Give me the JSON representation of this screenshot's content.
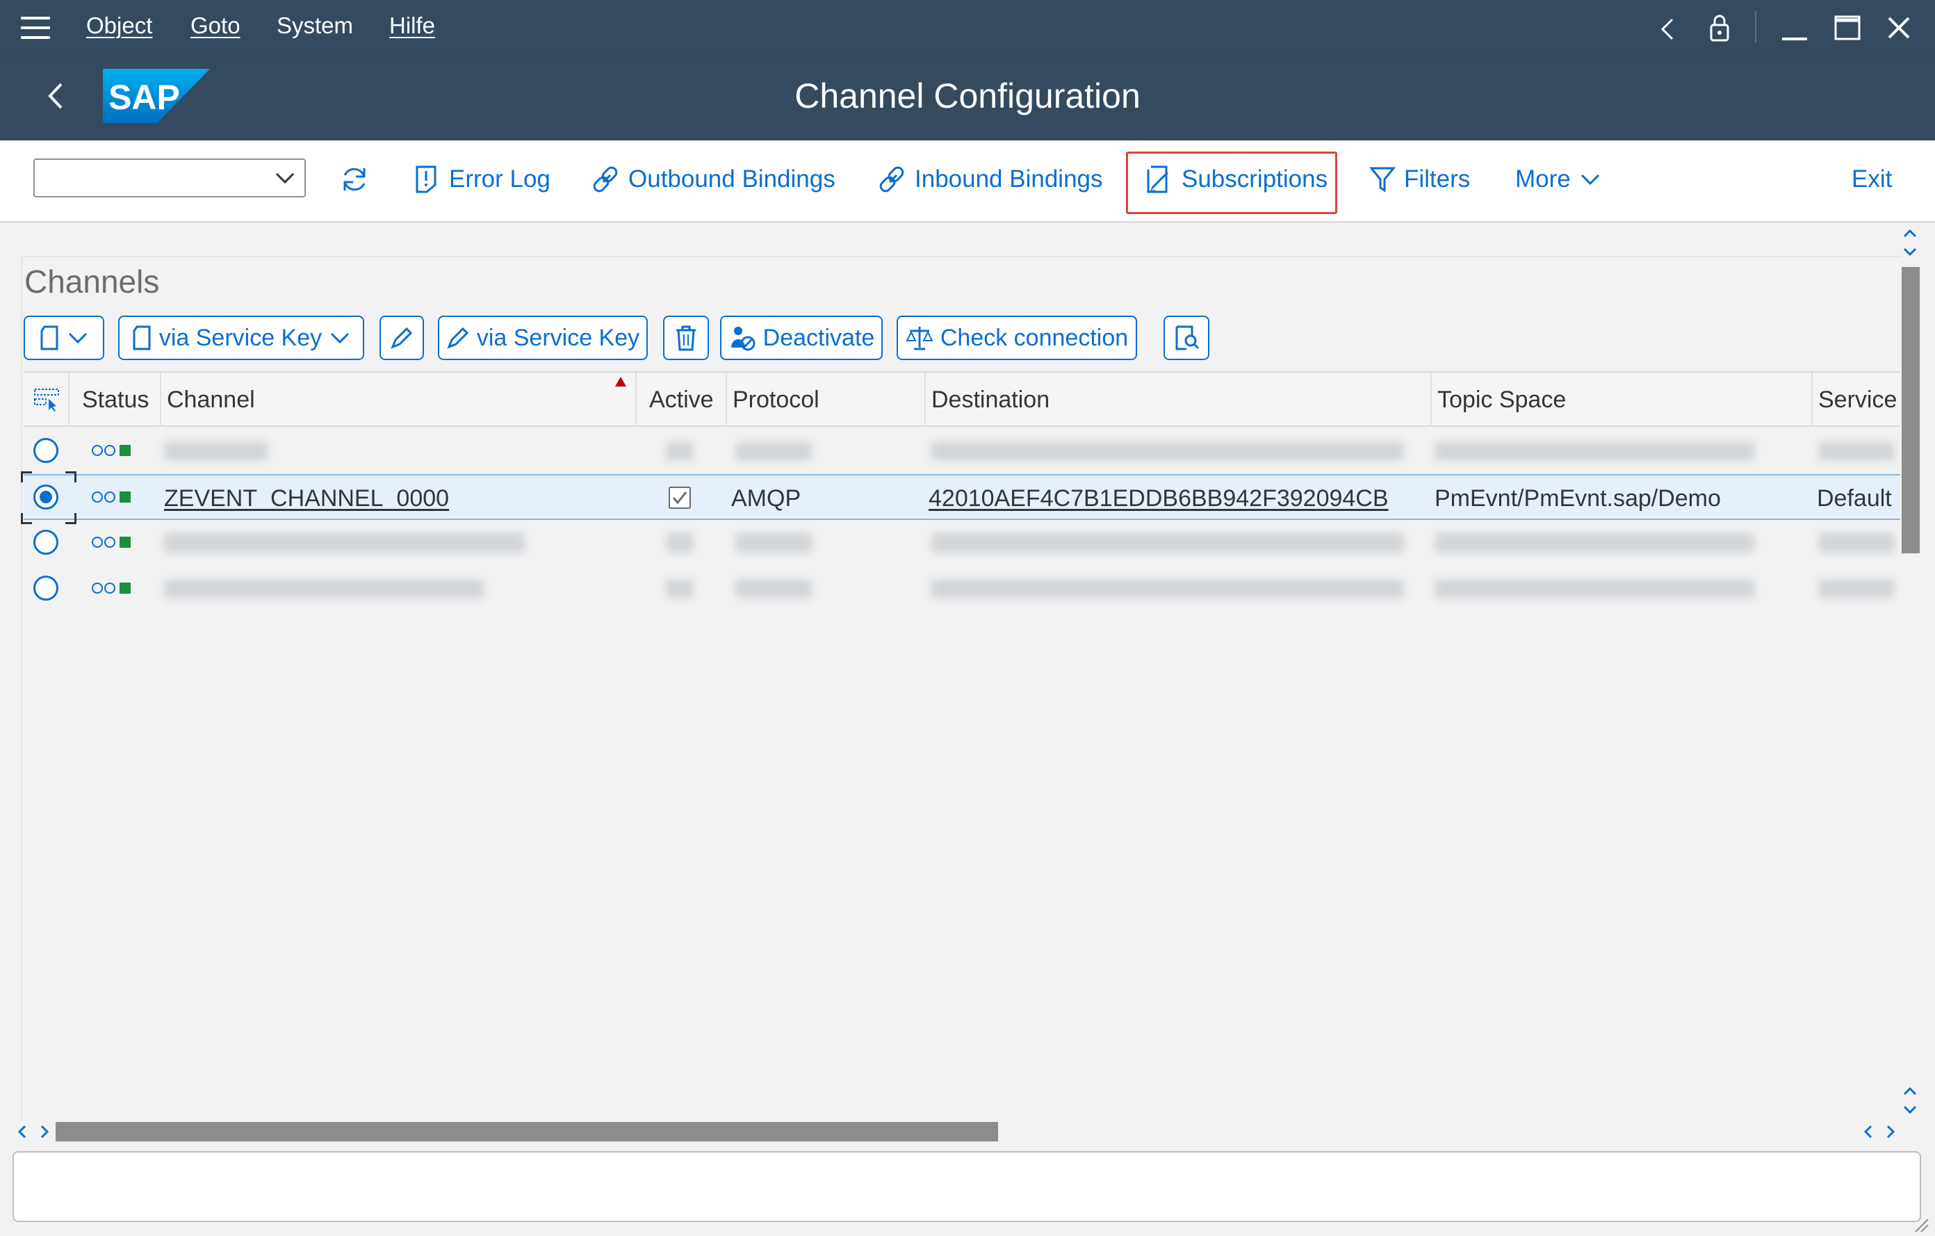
{
  "menubar": {
    "items": [
      "Object",
      "Goto",
      "System",
      "Hilfe"
    ]
  },
  "header": {
    "title": "Channel Configuration"
  },
  "toolbar": {
    "combo_value": "",
    "error_log": "Error Log",
    "outbound_bindings": "Outbound Bindings",
    "inbound_bindings": "Inbound Bindings",
    "subscriptions": "Subscriptions",
    "filters": "Filters",
    "more": "More",
    "exit": "Exit"
  },
  "panel": {
    "title": "Channels",
    "buttons": {
      "create_via_service_key": "via Service Key",
      "edit_via_service_key": "via Service Key",
      "deactivate": "Deactivate",
      "check_connection": "Check connection"
    }
  },
  "table": {
    "columns": [
      "Status",
      "Channel",
      "Active",
      "Protocol",
      "Destination",
      "Topic Space",
      "Service"
    ],
    "rows": [
      {
        "selected": false,
        "redacted": true
      },
      {
        "selected": true,
        "redacted": false,
        "channel": "ZEVENT_CHANNEL_0000",
        "active": true,
        "protocol": "AMQP",
        "destination": "42010AEF4C7B1EDDB6BB942F392094CB",
        "topic_space": "PmEvnt/PmEvnt.sap/Demo",
        "service": "Default"
      },
      {
        "selected": false,
        "redacted": true
      },
      {
        "selected": false,
        "redacted": true
      }
    ]
  },
  "colors": {
    "shell": "#354a5f",
    "accent": "#0a6ed1",
    "highlight_box": "#e04040",
    "status_green": "#1a8f3c"
  }
}
